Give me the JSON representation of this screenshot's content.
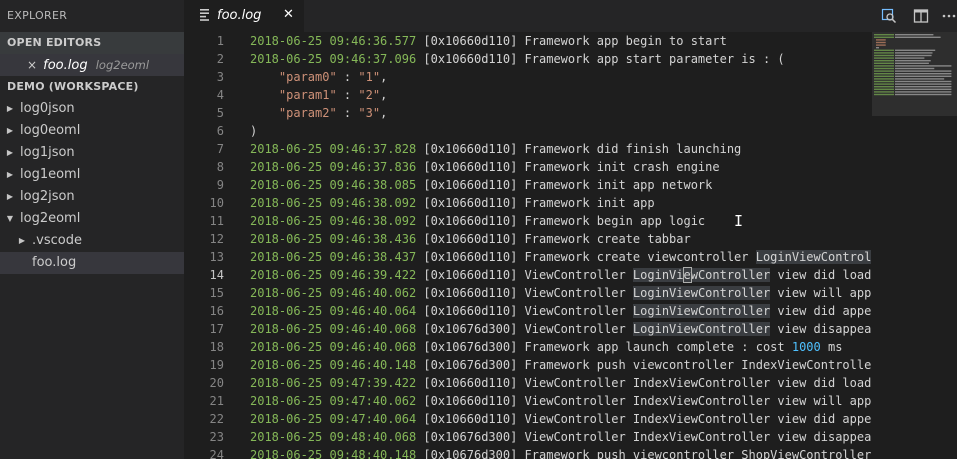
{
  "sidebar": {
    "title": "EXPLORER",
    "open_editors_header": "OPEN EDITORS",
    "open_editor": {
      "close_glyph": "×",
      "filename": "foo.log",
      "folder": "log2eoml"
    },
    "workspace_header": "DEMO (WORKSPACE)",
    "tree": [
      {
        "label": "log0json",
        "expanded": false
      },
      {
        "label": "log0eoml",
        "expanded": false
      },
      {
        "label": "log1json",
        "expanded": false
      },
      {
        "label": "log1eoml",
        "expanded": false
      },
      {
        "label": "log2json",
        "expanded": false
      },
      {
        "label": "log2eoml",
        "expanded": true
      },
      {
        "label": ".vscode",
        "expanded": false
      },
      {
        "label": "foo.log",
        "selected": true
      }
    ]
  },
  "tab": {
    "label": "foo.log",
    "close": "✕",
    "icon": "list-lines-icon"
  },
  "actions": [
    "open-preview-icon",
    "split-editor-icon",
    "more-actions-icon"
  ],
  "editor": {
    "active_line": 14,
    "colors": {
      "timestamp": "#85b858",
      "string": "#ce9178",
      "number": "#4fc1ff",
      "text": "#d4d4d4"
    },
    "lines": [
      {
        "n": "1",
        "ts": "2018-06-25 09:46:36.577",
        "rest": " [0x10660d110] Framework app begin to start"
      },
      {
        "n": "2",
        "ts": "2018-06-25 09:46:37.096",
        "rest": " [0x10660d110] Framework app start parameter is : ("
      },
      {
        "n": "3",
        "indent": "    ",
        "key": "\"param0\"",
        "sep": " : ",
        "val": "\"1\"",
        "end": ","
      },
      {
        "n": "4",
        "indent": "    ",
        "key": "\"param1\"",
        "sep": " : ",
        "val": "\"2\"",
        "end": ","
      },
      {
        "n": "5",
        "indent": "    ",
        "key": "\"param2\"",
        "sep": " : ",
        "val": "\"3\"",
        "end": ","
      },
      {
        "n": "6",
        "plain": ")"
      },
      {
        "n": "7",
        "ts": "2018-06-25 09:46:37.828",
        "rest": " [0x10660d110] Framework did finish launching"
      },
      {
        "n": "8",
        "ts": "2018-06-25 09:46:37.836",
        "rest": " [0x10660d110] Framework init crash engine"
      },
      {
        "n": "9",
        "ts": "2018-06-25 09:46:38.085",
        "rest": " [0x10660d110] Framework init app network"
      },
      {
        "n": "10",
        "ts": "2018-06-25 09:46:38.092",
        "rest": " [0x10660d110] Framework init app"
      },
      {
        "n": "11",
        "ts": "2018-06-25 09:46:38.092",
        "rest": " [0x10660d110] Framework begin app logic"
      },
      {
        "n": "12",
        "ts": "2018-06-25 09:46:38.436",
        "rest": " [0x10660d110] Framework create tabbar"
      },
      {
        "n": "13",
        "ts": "2018-06-25 09:46:38.437",
        "rest": " [0x10660d110] Framework create viewcontroller ",
        "hl": "LoginViewControl",
        "tail": ""
      },
      {
        "n": "14",
        "ts": "2018-06-25 09:46:39.422",
        "rest": " [0x10660d110] ViewController ",
        "hl_cursor": [
          "LoginVi",
          "e",
          "wController"
        ],
        "tail": " view did load"
      },
      {
        "n": "15",
        "ts": "2018-06-25 09:46:40.062",
        "rest": " [0x10660d110] ViewController ",
        "hl": "LoginViewController",
        "tail": " view will app"
      },
      {
        "n": "16",
        "ts": "2018-06-25 09:46:40.064",
        "rest": " [0x10660d110] ViewController ",
        "hl": "LoginViewController",
        "tail": " view did appe"
      },
      {
        "n": "17",
        "ts": "2018-06-25 09:46:40.068",
        "rest": " [0x10676d300] ViewController ",
        "hl": "LoginViewController",
        "tail": " view disappea"
      },
      {
        "n": "18",
        "ts": "2018-06-25 09:46:40.068",
        "rest": " [0x10676d300] Framework app launch complete : cost ",
        "num": "1000",
        "tail": " ms"
      },
      {
        "n": "19",
        "ts": "2018-06-25 09:46:40.148",
        "rest": " [0x10676d300] Framework push viewcontroller IndexViewControlle"
      },
      {
        "n": "20",
        "ts": "2018-06-25 09:47:39.422",
        "rest": " [0x10660d110] ViewController IndexViewController view did load"
      },
      {
        "n": "21",
        "ts": "2018-06-25 09:47:40.062",
        "rest": " [0x10660d110] ViewController IndexViewController view will app"
      },
      {
        "n": "22",
        "ts": "2018-06-25 09:47:40.064",
        "rest": " [0x10660d110] ViewController IndexViewController view did appe"
      },
      {
        "n": "23",
        "ts": "2018-06-25 09:48:40.068",
        "rest": " [0x10676d300] ViewController IndexViewController view disappea"
      },
      {
        "n": "24",
        "ts": "2018-06-25 09:48:40.148",
        "rest": " [0x10676d300] Framework push viewcontroller ShopViewController"
      }
    ]
  }
}
